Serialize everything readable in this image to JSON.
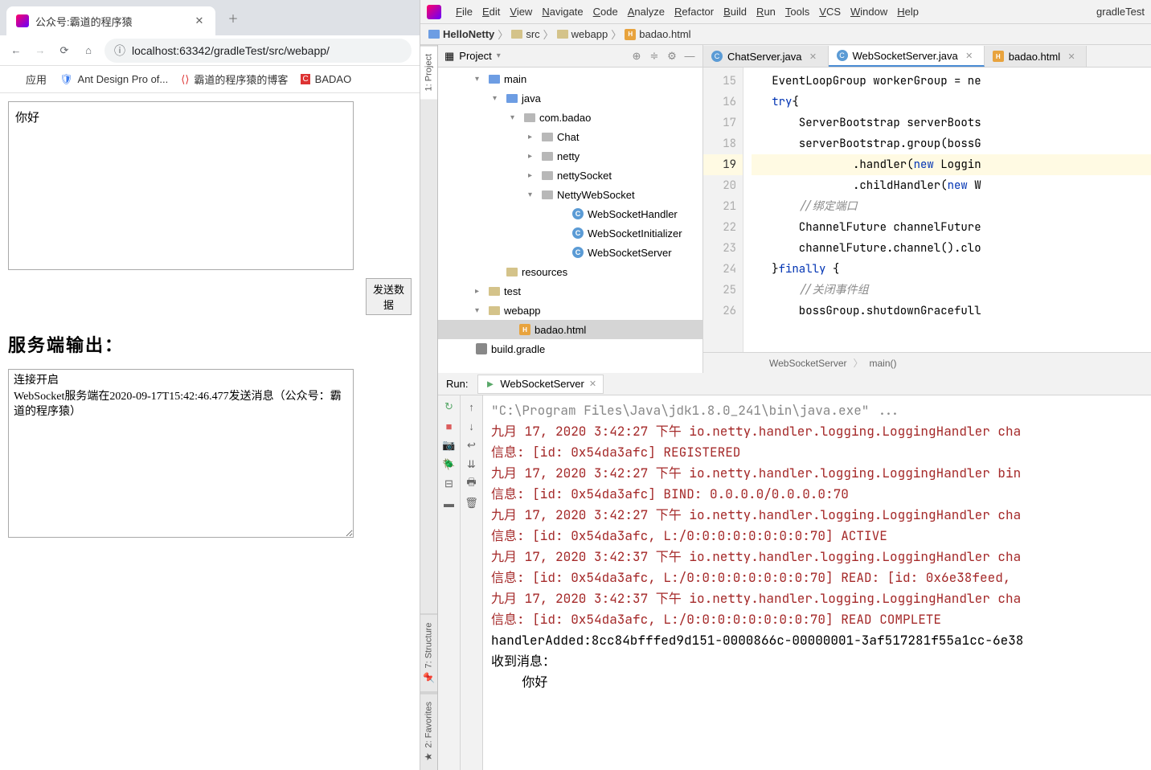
{
  "browser": {
    "tab_title": "公众号:霸道的程序猿",
    "address": "localhost:63342/gradleTest/src/webapp/",
    "bookmarks": {
      "apps": "应用",
      "ant": "Ant Design Pro of...",
      "blog": "霸道的程序猿的博客",
      "badao": "BADAO"
    },
    "input_value": "你好",
    "send_btn": "发送数据",
    "output_title": "服务端输出：",
    "output_text": "连接开启\nWebSocket服务端在2020-09-17T15:42:46.477发送消息（公众号：霸道的程序猿）"
  },
  "ide": {
    "menu": [
      "File",
      "Edit",
      "View",
      "Navigate",
      "Code",
      "Analyze",
      "Refactor",
      "Build",
      "Run",
      "Tools",
      "VCS",
      "Window",
      "Help"
    ],
    "menu_right": "gradleTest",
    "breadcrumb": [
      "HelloNetty",
      "src",
      "webapp",
      "badao.html"
    ],
    "project_panel": {
      "title": "Project",
      "tree": [
        {
          "indent": 46,
          "arrow": "▾",
          "icon": "dir-blue",
          "label": "main"
        },
        {
          "indent": 68,
          "arrow": "▾",
          "icon": "dir-blue",
          "label": "java"
        },
        {
          "indent": 90,
          "arrow": "▾",
          "icon": "dir-gray",
          "label": "com.badao"
        },
        {
          "indent": 112,
          "arrow": "▸",
          "icon": "dir-gray",
          "label": "Chat"
        },
        {
          "indent": 112,
          "arrow": "▸",
          "icon": "dir-gray",
          "label": "netty"
        },
        {
          "indent": 112,
          "arrow": "▸",
          "icon": "dir-gray",
          "label": "nettySocket"
        },
        {
          "indent": 112,
          "arrow": "▾",
          "icon": "dir-gray",
          "label": "NettyWebSocket"
        },
        {
          "indent": 150,
          "arrow": "",
          "icon": "class",
          "label": "WebSocketHandler"
        },
        {
          "indent": 150,
          "arrow": "",
          "icon": "class",
          "label": "WebSocketInitializer"
        },
        {
          "indent": 150,
          "arrow": "",
          "icon": "class",
          "label": "WebSocketServer"
        },
        {
          "indent": 68,
          "arrow": "",
          "icon": "dir",
          "label": "resources"
        },
        {
          "indent": 46,
          "arrow": "▸",
          "icon": "dir",
          "label": "test"
        },
        {
          "indent": 46,
          "arrow": "▾",
          "icon": "dir",
          "label": "webapp"
        },
        {
          "indent": 84,
          "arrow": "",
          "icon": "html",
          "label": "badao.html",
          "selected": true
        },
        {
          "indent": 30,
          "arrow": "",
          "icon": "gradle",
          "label": "build.gradle"
        }
      ]
    },
    "file_tabs": [
      {
        "icon": "java",
        "label": "ChatServer.java",
        "active": false
      },
      {
        "icon": "java",
        "label": "WebSocketServer.java",
        "active": true
      },
      {
        "icon": "html",
        "label": "badao.html",
        "active": false
      }
    ],
    "code": {
      "gutter": [
        "15",
        "16",
        "17",
        "18",
        "19",
        "20",
        "21",
        "22",
        "23",
        "24",
        "25",
        "26"
      ],
      "highlight_line": 4,
      "lines": [
        "   EventLoopGroup workerGroup = ne",
        "   try{",
        "       ServerBootstrap serverBoots",
        "       serverBootstrap.group(bossG",
        "               .handler(new Loggin",
        "               .childHandler(new W",
        "       //绑定端口",
        "       ChannelFuture channelFuture",
        "       channelFuture.channel().clo",
        "   }finally {",
        "       //关闭事件组",
        "       bossGroup.shutdownGracefull"
      ]
    },
    "code_breadcrumb": [
      "WebSocketServer",
      "main()"
    ],
    "run": {
      "label": "Run:",
      "tab": "WebSocketServer",
      "lines": [
        {
          "cls": "gray",
          "text": "\"C:\\Program Files\\Java\\jdk1.8.0_241\\bin\\java.exe\" ..."
        },
        {
          "cls": "info",
          "text": "九月 17, 2020 3:42:27 下午 io.netty.handler.logging.LoggingHandler cha"
        },
        {
          "cls": "info",
          "text": "信息: [id: 0x54da3afc] REGISTERED"
        },
        {
          "cls": "info",
          "text": "九月 17, 2020 3:42:27 下午 io.netty.handler.logging.LoggingHandler bin"
        },
        {
          "cls": "info",
          "text": "信息: [id: 0x54da3afc] BIND: 0.0.0.0/0.0.0.0:70"
        },
        {
          "cls": "info",
          "text": "九月 17, 2020 3:42:27 下午 io.netty.handler.logging.LoggingHandler cha"
        },
        {
          "cls": "info",
          "text": "信息: [id: 0x54da3afc, L:/0:0:0:0:0:0:0:0:70] ACTIVE"
        },
        {
          "cls": "info",
          "text": "九月 17, 2020 3:42:37 下午 io.netty.handler.logging.LoggingHandler cha"
        },
        {
          "cls": "info",
          "text": "信息: [id: 0x54da3afc, L:/0:0:0:0:0:0:0:0:70] READ: [id: 0x6e38feed, "
        },
        {
          "cls": "info",
          "text": "九月 17, 2020 3:42:37 下午 io.netty.handler.logging.LoggingHandler cha"
        },
        {
          "cls": "info",
          "text": "信息: [id: 0x54da3afc, L:/0:0:0:0:0:0:0:0:70] READ COMPLETE"
        },
        {
          "cls": "",
          "text": "handlerAdded:8cc84bfffed9d151-0000866c-00000001-3af517281f55a1cc-6e38"
        },
        {
          "cls": "",
          "text": "收到消息："
        },
        {
          "cls": "",
          "text": "    你好"
        }
      ]
    },
    "side_tools": {
      "project": "1: Project",
      "structure": "7: Structure",
      "favorites": "2: Favorites"
    }
  }
}
